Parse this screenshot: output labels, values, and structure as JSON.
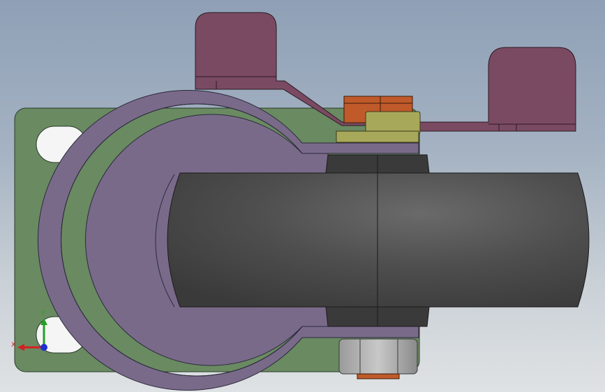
{
  "viewport": {
    "background_top": "#8fa0b6",
    "background_bottom": "#dfe2e4"
  },
  "parts": {
    "base_plate": {
      "color": "#6a8a62",
      "icon": "mounting-plate"
    },
    "fork_bracket": {
      "color": "#7a6a8a",
      "icon": "caster-fork"
    },
    "brake_pedal": {
      "color": "#7a4a62",
      "icon": "brake-lever"
    },
    "wheel": {
      "color": "#4a4a4a",
      "icon": "caster-wheel"
    },
    "hub_nut": {
      "color": "#8a8a8a",
      "icon": "hex-nut"
    },
    "top_nut": {
      "color": "#c05a2a",
      "icon": "hex-nut"
    },
    "washer": {
      "color": "#a8a85a",
      "icon": "washer"
    }
  },
  "triad": {
    "x_label": "X",
    "y_label": "Y",
    "x_color": "#d42020",
    "y_color": "#22a022",
    "z_color": "#2030d0"
  }
}
